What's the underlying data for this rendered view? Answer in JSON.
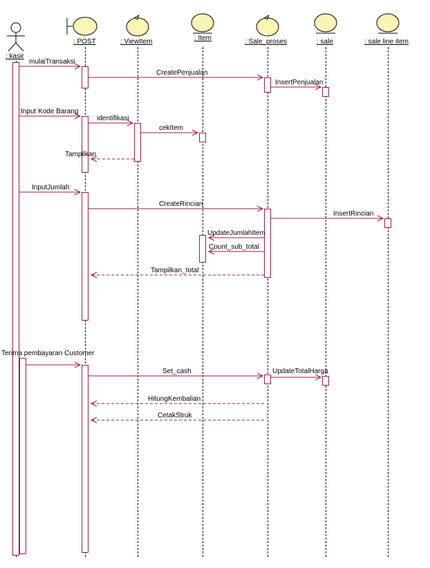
{
  "lifelines": {
    "kasir": {
      "label": ": kasir"
    },
    "post": {
      "label": ": POST"
    },
    "viewItem": {
      "label": ": ViewItem"
    },
    "item": {
      "label": ": Item"
    },
    "saleProses": {
      "label": ": Sale_proses"
    },
    "sale": {
      "label": ": sale"
    },
    "saleLineItem": {
      "label": ": sale line item"
    }
  },
  "messages": {
    "mulaiTransaksi": "mulaiTransaksi",
    "createPenjualan": "CreatePenjualan",
    "insertPenjualan": "InsertPenjualan",
    "inputKodeBarang": "Input Kode Barang",
    "identifikasi": "identifikasi",
    "cekItem": "cekItem",
    "tampilkan": "Tampilkan",
    "inputJumlah": "InputJumlah",
    "createRincian": "CreateRincian",
    "insertRincian": "InsertRincian",
    "updateJumlahItem": "UpdateJumlahItem",
    "countSubTotal": "Count_sub_total",
    "tampilkanTotal": "Tampilkan_total",
    "terimaPembayaran": "Terima pembayaran Customer",
    "setCash": "Set_cash",
    "updateTotalHarga": "UpdateTotalHarga",
    "hitungKembalian": "HitungKembalian",
    "cetakStruk": "CetakStruk"
  },
  "colors": {
    "accent": "#a11846",
    "fill": "#fbf6b6"
  }
}
